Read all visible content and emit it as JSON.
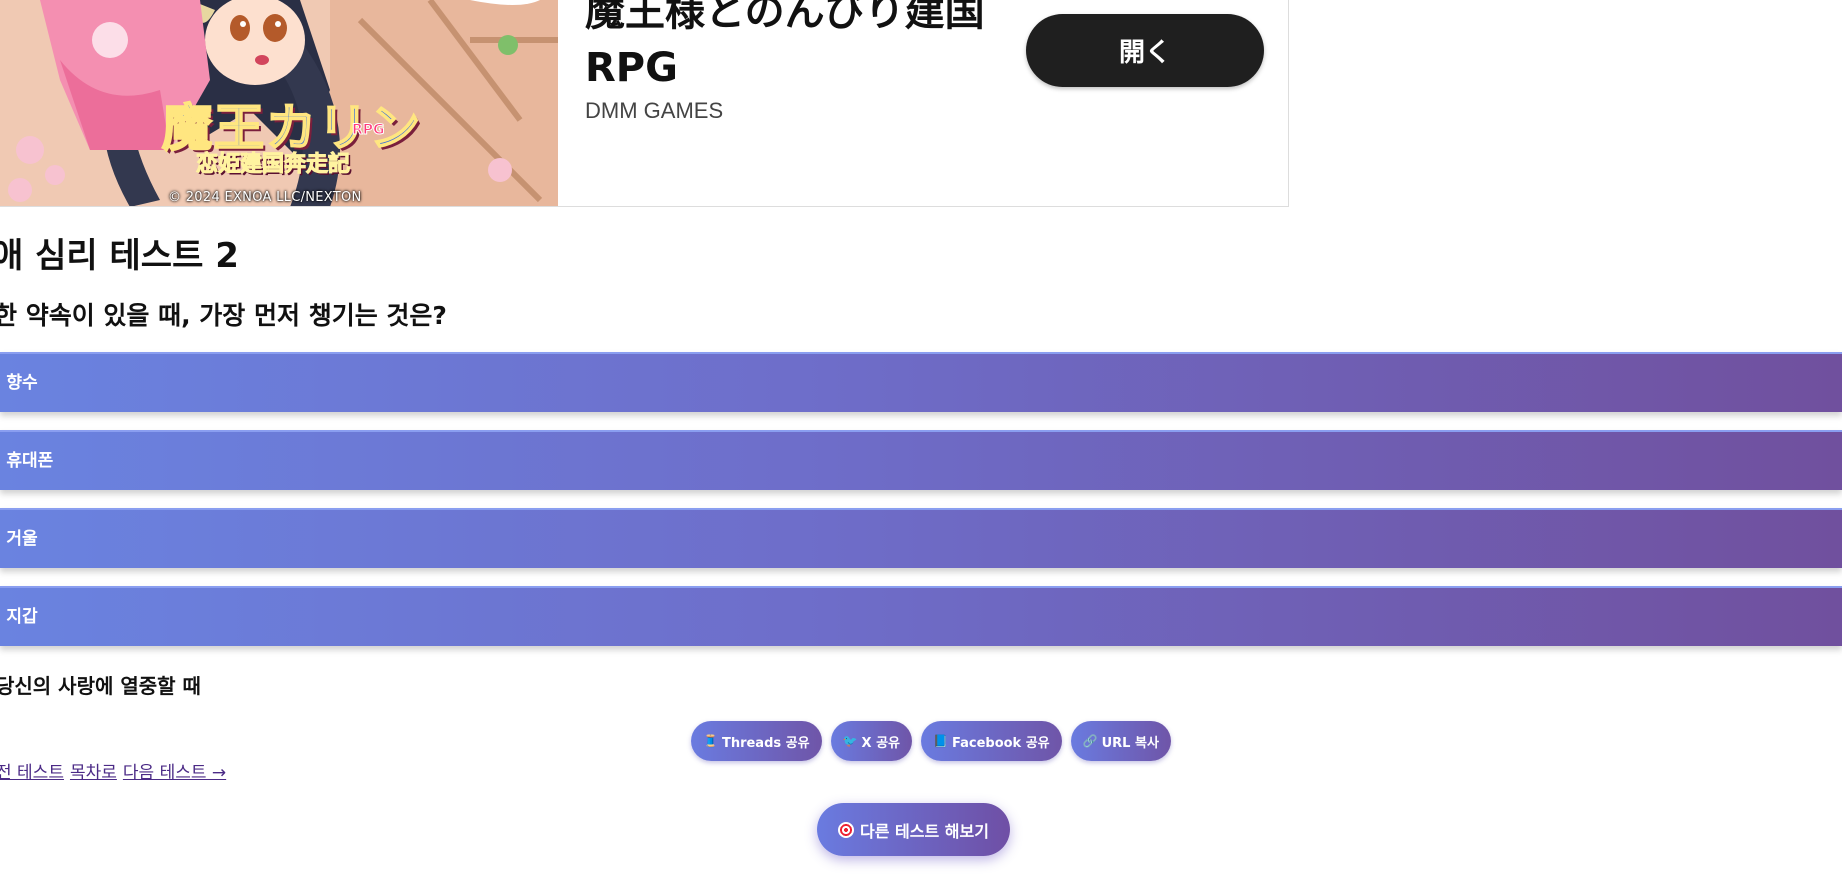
{
  "ad": {
    "title": "魔王様とのんびり建国RPG",
    "publisher": "DMM GAMES",
    "open_label": "開く",
    "image": {
      "logo_word": "魔王カリン",
      "logo_badge": "RPG",
      "logo_sub": "恋姫建国奔走記",
      "copyright": "© 2024 EXNOA LLC/NEXTON"
    }
  },
  "test": {
    "title": "애 심리 테스트 2",
    "question": "한 약속이 있을 때, 가장 먼저 챙기는 것은?",
    "options": [
      {
        "label": ". 향수"
      },
      {
        "label": ". 휴대폰"
      },
      {
        "label": ". 거울"
      },
      {
        "label": ". 지갑"
      }
    ],
    "result": "당신의 사랑에 열중할 때"
  },
  "share": [
    {
      "icon": "threads-icon",
      "glyph": "🧵",
      "label": "Threads 공유"
    },
    {
      "icon": "x-icon",
      "glyph": "🐦",
      "label": "X 공유"
    },
    {
      "icon": "facebook-icon",
      "glyph": "📘",
      "label": "Facebook 공유"
    },
    {
      "icon": "link-icon",
      "glyph": "🔗",
      "label": "URL 복사"
    }
  ],
  "nav": {
    "prev": "전 테스트",
    "list": "목차로",
    "next": "다음 테스트 →"
  },
  "other_test_label": "다른 테스트 해보기",
  "colors": {
    "option_gradient_start": "#6a83e0",
    "option_gradient_end": "#70509e",
    "ad_button": "#1f1f1f",
    "link": "#4b2a86"
  }
}
